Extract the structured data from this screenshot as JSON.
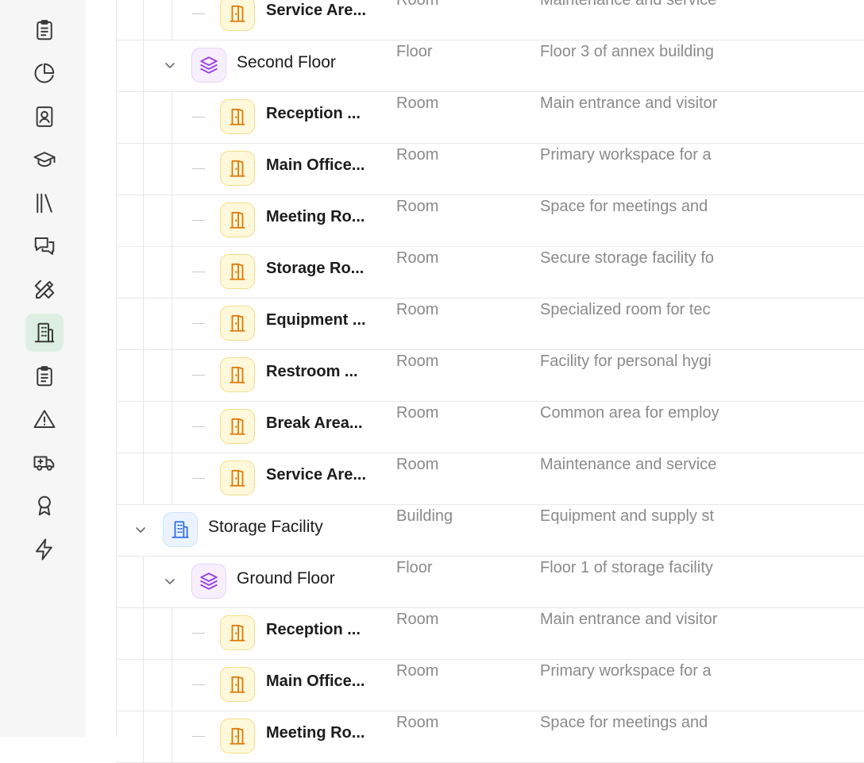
{
  "sidebar": {
    "items": [
      {
        "icon": "clipboard-list-icon",
        "active": false
      },
      {
        "icon": "pie-chart-icon",
        "active": false
      },
      {
        "icon": "contact-book-icon",
        "active": false
      },
      {
        "icon": "graduation-cap-icon",
        "active": false
      },
      {
        "icon": "library-icon",
        "active": false
      },
      {
        "icon": "messages-icon",
        "active": false
      },
      {
        "icon": "pencil-ruler-icon",
        "active": false
      },
      {
        "icon": "building-icon",
        "active": true
      },
      {
        "icon": "clipboard-list-icon",
        "active": false
      },
      {
        "icon": "alert-triangle-icon",
        "active": false
      },
      {
        "icon": "ambulance-icon",
        "active": false
      },
      {
        "icon": "award-icon",
        "active": false
      },
      {
        "icon": "zap-icon",
        "active": false
      }
    ]
  },
  "rows": [
    {
      "level": 2,
      "kind": "room",
      "name": "Service Are...",
      "type": "Room",
      "description": "Maintenance and service"
    },
    {
      "level": 1,
      "kind": "floor",
      "name": "Second Floor",
      "type": "Floor",
      "description": "Floor 3 of annex building"
    },
    {
      "level": 2,
      "kind": "room",
      "name": "Reception ...",
      "type": "Room",
      "description": "Main entrance and visitor"
    },
    {
      "level": 2,
      "kind": "room",
      "name": "Main Office...",
      "type": "Room",
      "description": "Primary workspace for a"
    },
    {
      "level": 2,
      "kind": "room",
      "name": "Meeting Ro...",
      "type": "Room",
      "description": "Space for meetings and"
    },
    {
      "level": 2,
      "kind": "room",
      "name": "Storage Ro...",
      "type": "Room",
      "description": "Secure storage facility fo"
    },
    {
      "level": 2,
      "kind": "room",
      "name": "Equipment ...",
      "type": "Room",
      "description": "Specialized room for tec"
    },
    {
      "level": 2,
      "kind": "room",
      "name": "Restroom ...",
      "type": "Room",
      "description": "Facility for personal hygi"
    },
    {
      "level": 2,
      "kind": "room",
      "name": "Break Area...",
      "type": "Room",
      "description": "Common area for employ"
    },
    {
      "level": 2,
      "kind": "room",
      "name": "Service Are...",
      "type": "Room",
      "description": "Maintenance and service"
    },
    {
      "level": 0,
      "kind": "building",
      "name": "Storage Facility",
      "type": "Building",
      "description": "Equipment and supply st"
    },
    {
      "level": 1,
      "kind": "floor",
      "name": "Ground Floor",
      "type": "Floor",
      "description": "Floor 1 of storage facility"
    },
    {
      "level": 2,
      "kind": "room",
      "name": "Reception ...",
      "type": "Room",
      "description": "Main entrance and visitor"
    },
    {
      "level": 2,
      "kind": "room",
      "name": "Main Office...",
      "type": "Room",
      "description": "Primary workspace for a"
    },
    {
      "level": 2,
      "kind": "room",
      "name": "Meeting Ro...",
      "type": "Room",
      "description": "Space for meetings and"
    }
  ],
  "colors": {
    "room": "#e07a0a",
    "floor": "#9b3fe0",
    "building": "#2f6fe0",
    "active_nav_bg": "#dcefe2"
  }
}
